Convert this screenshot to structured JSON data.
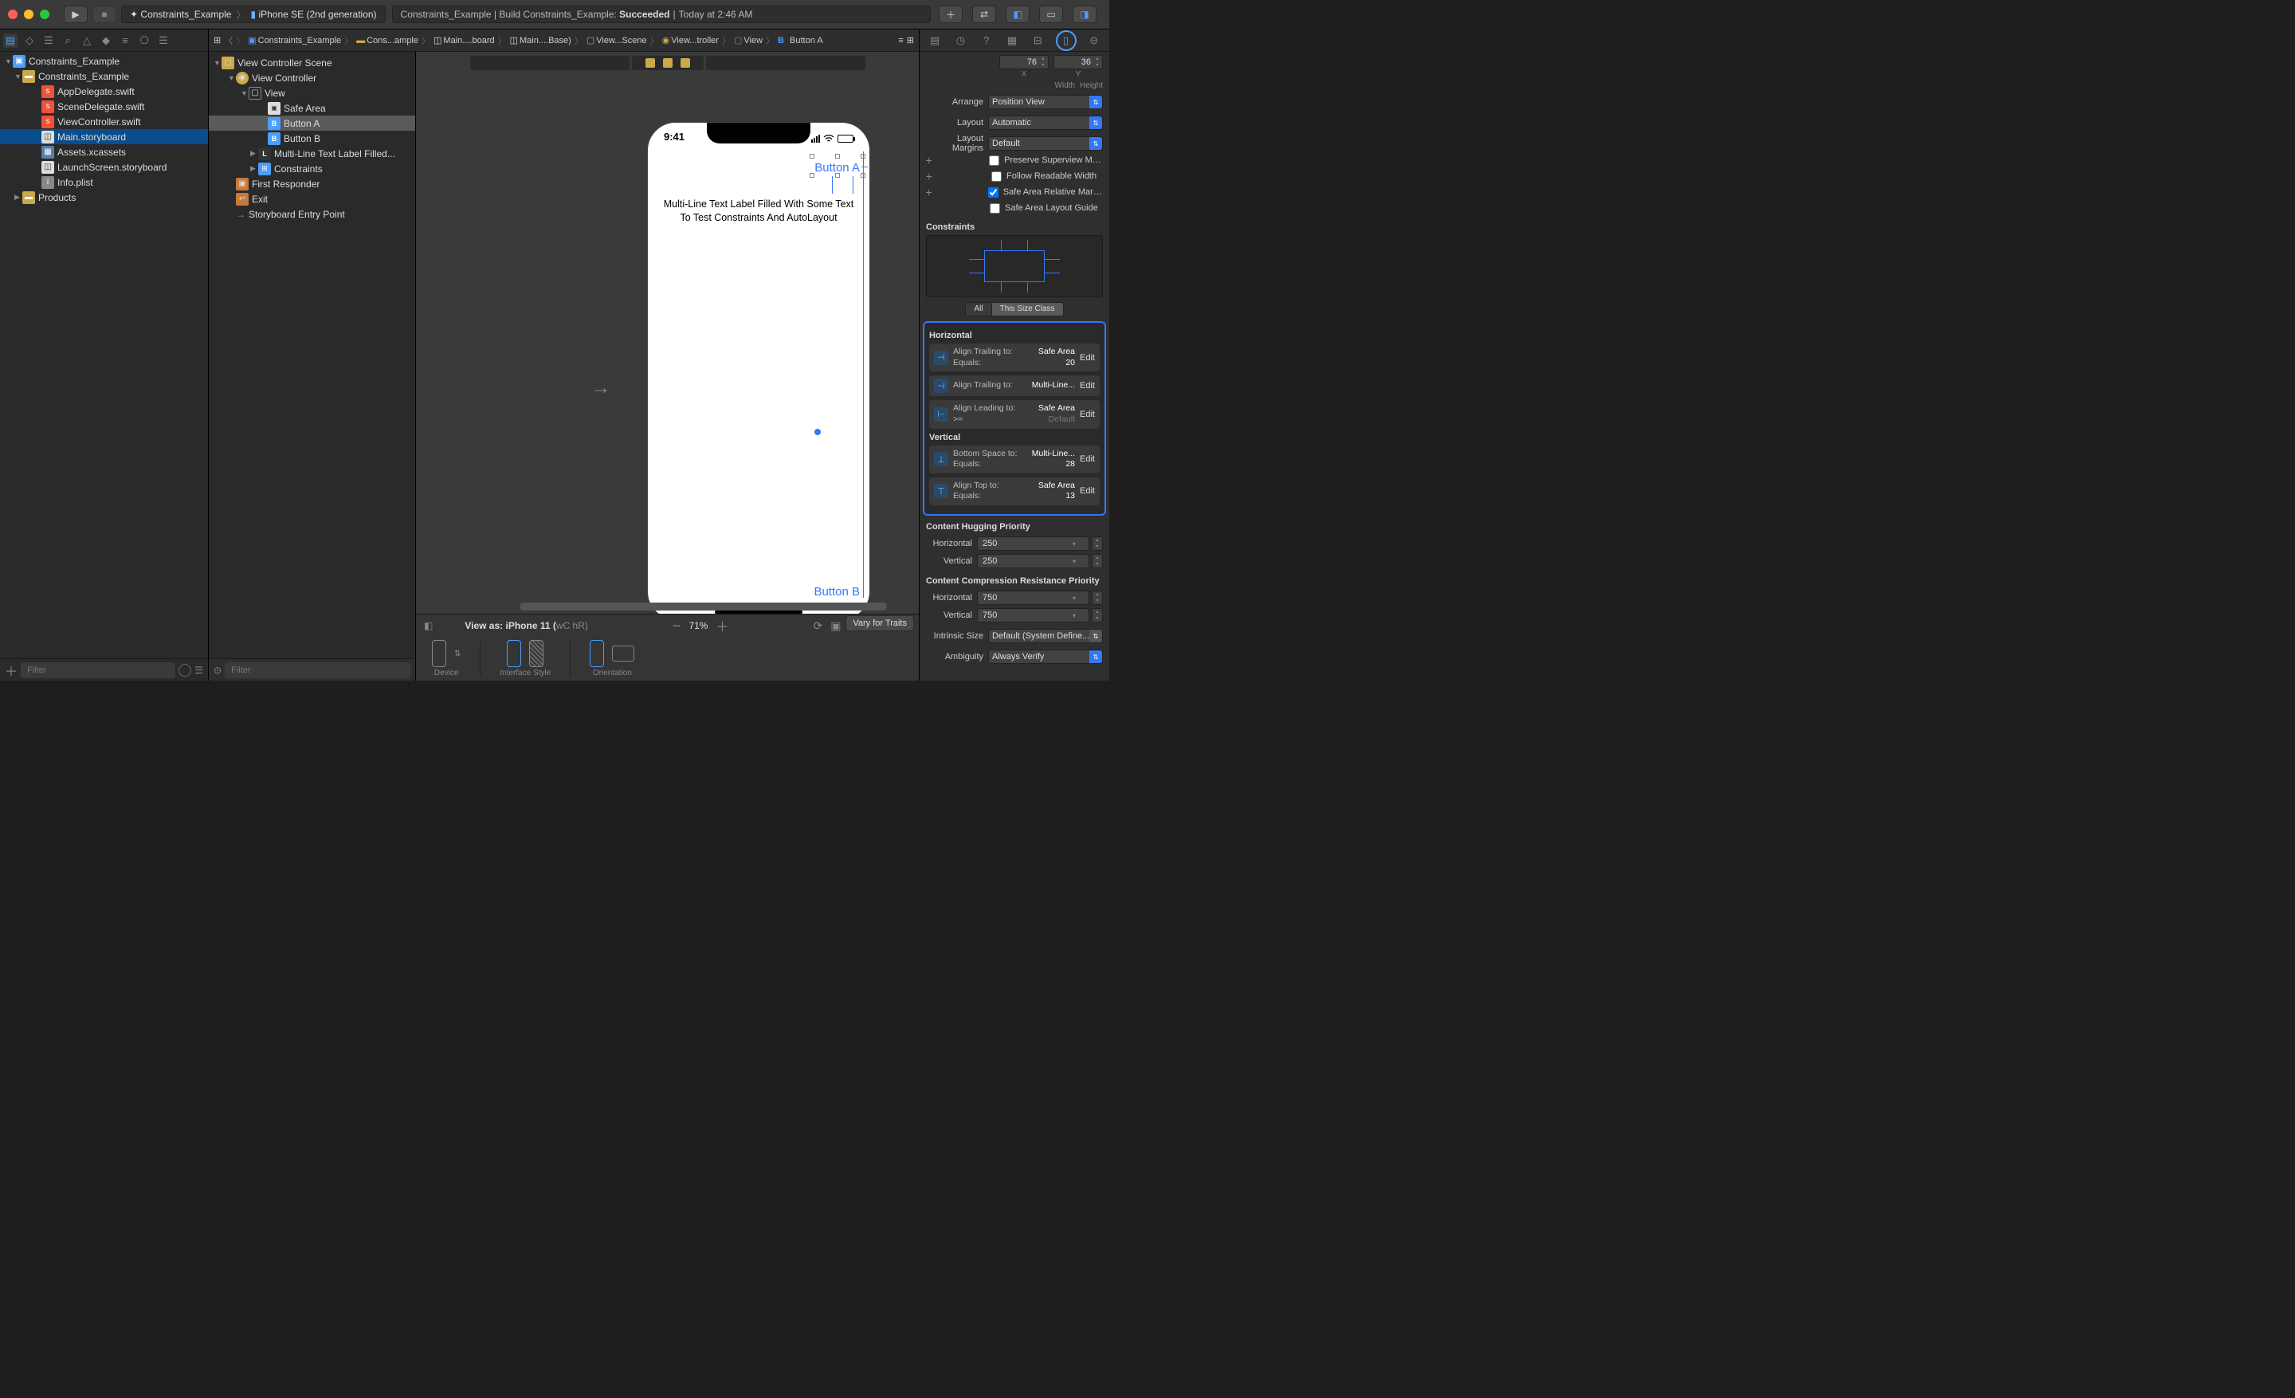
{
  "titlebar": {
    "scheme_project": "Constraints_Example",
    "scheme_device": "iPhone SE (2nd generation)",
    "status_prefix": "Constraints_Example | Build Constraints_Example:",
    "status_result": "Succeeded",
    "status_time": "Today at 2:46 AM"
  },
  "navigator": {
    "project": "Constraints_Example",
    "group": "Constraints_Example",
    "files": {
      "appdelegate": "AppDelegate.swift",
      "scenedelegate": "SceneDelegate.swift",
      "viewcontroller": "ViewController.swift",
      "mainstoryboard": "Main.storyboard",
      "assets": "Assets.xcassets",
      "launchscreen": "LaunchScreen.storyboard",
      "infoplist": "Info.plist"
    },
    "products": "Products",
    "filter_placeholder": "Filter"
  },
  "jumpbar": {
    "p0": "Constraints_Example",
    "p1": "Cons...ample",
    "p2": "Main....board",
    "p3": "Main....Base)",
    "p4": "View...Scene",
    "p5": "View...troller",
    "p6": "View",
    "p7": "Button A"
  },
  "outline": {
    "scene": "View Controller Scene",
    "vc": "View Controller",
    "view": "View",
    "safearea": "Safe Area",
    "buttonA": "Button A",
    "buttonB": "Button B",
    "multiline": "Multi-Line Text Label Filled...",
    "constraints": "Constraints",
    "firstresponder": "First Responder",
    "exit": "Exit",
    "entrypoint": "Storyboard Entry Point",
    "filter_placeholder": "Filter"
  },
  "device": {
    "time": "9:41",
    "buttonA": "Button A",
    "multiline": "Multi-Line Text Label Filled With Some Text To Test Constraints And AutoLayout",
    "buttonB": "Button B"
  },
  "bottombar": {
    "viewas": "View as: iPhone 11 (",
    "wc": "wC",
    "hr": " hR)",
    "zoom": "71%",
    "device_label": "Device",
    "style_label": "Interface Style",
    "orientation_label": "Orientation",
    "vary": "Vary for Traits"
  },
  "inspector": {
    "x": "X",
    "y": "Y",
    "x_val": "76",
    "y_val": "36",
    "width": "Width",
    "height": "Height",
    "arrange": "Arrange",
    "arrange_val": "Position View",
    "layout": "Layout",
    "layout_val": "Automatic",
    "margins": "Layout Margins",
    "margins_val": "Default",
    "preserve": "Preserve Superview Mar...",
    "readable": "Follow Readable Width",
    "saferel": "Safe Area Relative Margins",
    "safeguide": "Safe Area Layout Guide",
    "constraints_hdr": "Constraints",
    "all": "All",
    "thissize": "This Size Class",
    "horizontal": "Horizontal",
    "vertical": "Vertical",
    "c1_l1": "Align Trailing to:",
    "c1_v1": "Safe Area",
    "c1_l2": "Equals:",
    "c1_v2": "20",
    "c2_l1": "Align Trailing to:",
    "c2_v1": "Multi-Line...",
    "c3_l1": "Align Leading to:",
    "c3_v1": "Safe Area",
    "c3_l2": ">=",
    "c3_v2": "Default",
    "c4_l1": "Bottom Space to:",
    "c4_v1": "Multi-Line...",
    "c4_l2": "Equals:",
    "c4_v2": "28",
    "c5_l1": "Align Top to:",
    "c5_v1": "Safe Area",
    "c5_l2": "Equals:",
    "c5_v2": "13",
    "edit": "Edit",
    "hugging_hdr": "Content Hugging Priority",
    "compression_hdr": "Content Compression Resistance Priority",
    "horiz": "Horizontal",
    "vert": "Vertical",
    "h250": "250",
    "v250": "250",
    "h750": "750",
    "v750": "750",
    "intrinsic": "Intrinsic Size",
    "intrinsic_val": "Default (System Define...",
    "ambiguity": "Ambiguity",
    "ambiguity_val": "Always Verify"
  }
}
